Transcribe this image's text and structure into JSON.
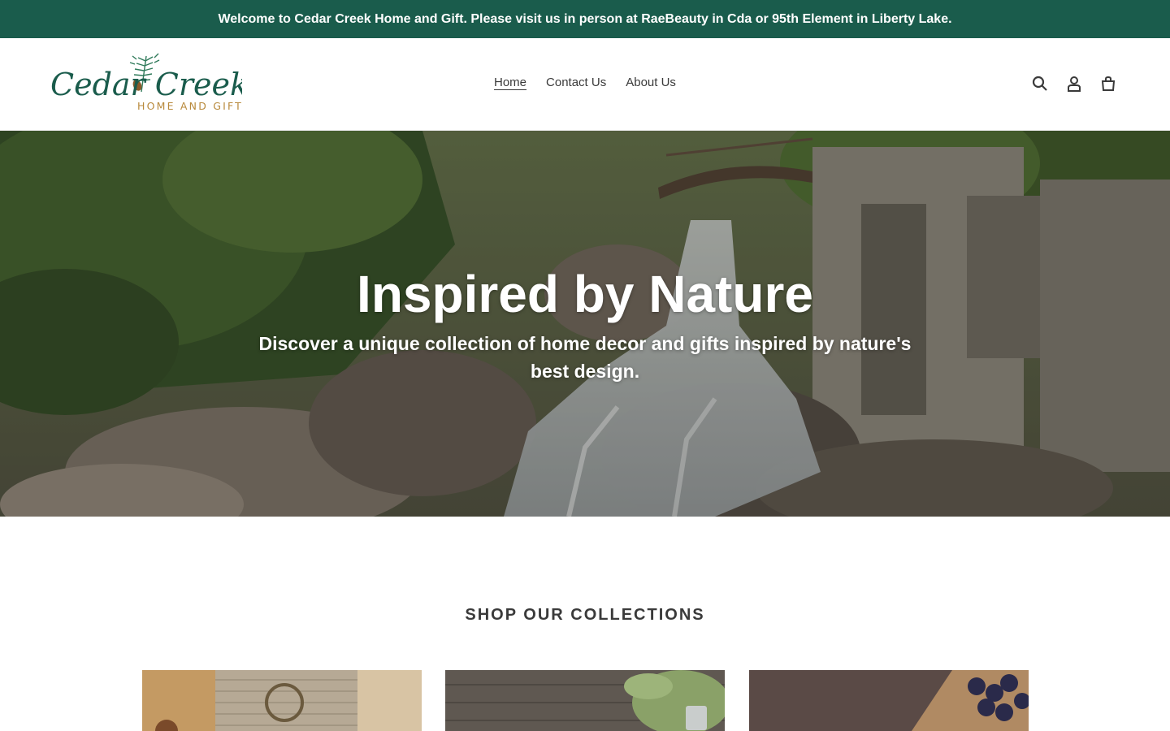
{
  "announcement": {
    "text": "Welcome to Cedar Creek Home and Gift. Please visit us in person at RaeBeauty in Cda or 95th Element in Liberty Lake."
  },
  "header": {
    "logo": {
      "main": "Cedar Creek",
      "tagline": "HOME AND GIFT",
      "colors": {
        "main": "#1a5c4c",
        "tagline": "#b8893b"
      }
    },
    "nav": [
      {
        "label": "Home",
        "active": true
      },
      {
        "label": "Contact Us",
        "active": false
      },
      {
        "label": "About Us",
        "active": false
      }
    ],
    "icons": [
      "search-icon",
      "account-icon",
      "cart-icon"
    ]
  },
  "hero": {
    "title": "Inspired by Nature",
    "subtitle": "Discover a unique collection of home decor and gifts inspired by nature's best design."
  },
  "collections": {
    "heading": "SHOP OUR COLLECTIONS"
  },
  "colors": {
    "brand": "#1a5c4c",
    "text": "#3a3a3a",
    "background": "#ffffff"
  }
}
